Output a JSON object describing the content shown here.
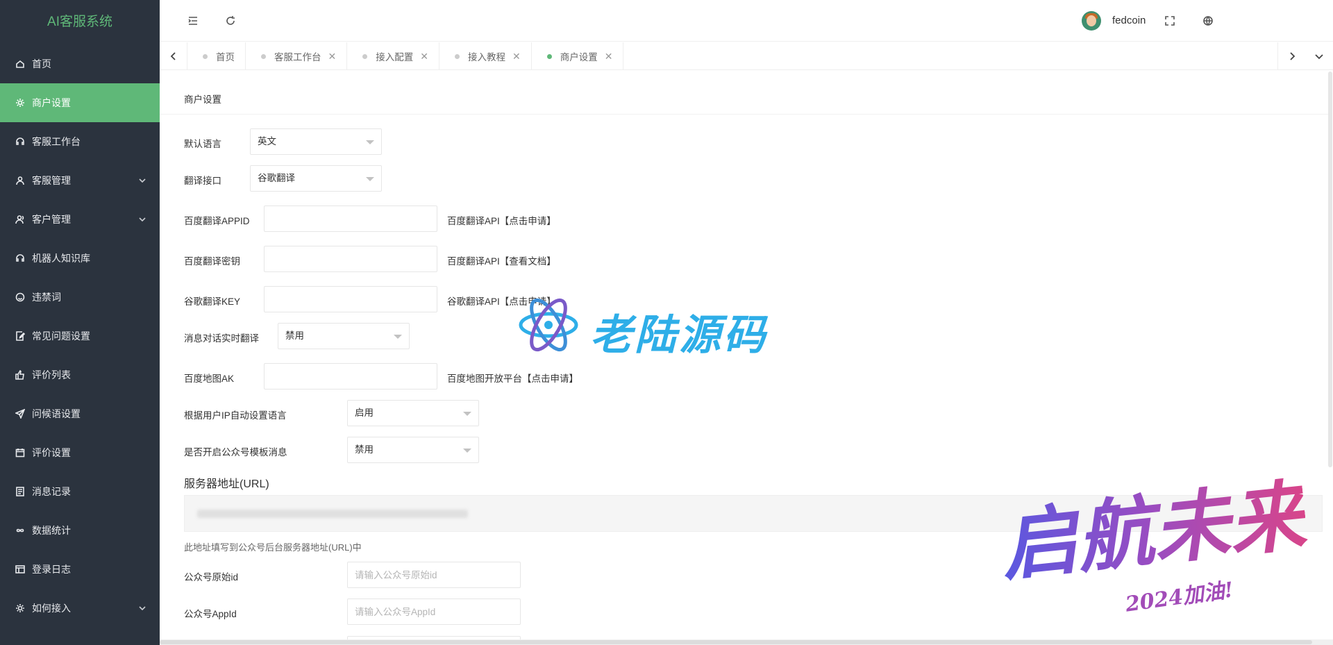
{
  "app": {
    "title": "AI客服系统"
  },
  "sidebar": {
    "items": [
      {
        "label": "首页",
        "icon": "home-icon",
        "active": false,
        "expandable": false
      },
      {
        "label": "商户设置",
        "icon": "gear-icon",
        "active": true,
        "expandable": false
      },
      {
        "label": "客服工作台",
        "icon": "headset-icon",
        "active": false,
        "expandable": false
      },
      {
        "label": "客服管理",
        "icon": "user-icon",
        "active": false,
        "expandable": true
      },
      {
        "label": "客户管理",
        "icon": "user-group-icon",
        "active": false,
        "expandable": true
      },
      {
        "label": "机器人知识库",
        "icon": "headset-icon",
        "active": false,
        "expandable": false
      },
      {
        "label": "违禁词",
        "icon": "smile-icon",
        "active": false,
        "expandable": false
      },
      {
        "label": "常见问题设置",
        "icon": "edit-doc-icon",
        "active": false,
        "expandable": false
      },
      {
        "label": "评价列表",
        "icon": "thumbs-up-icon",
        "active": false,
        "expandable": false
      },
      {
        "label": "问候语设置",
        "icon": "send-icon",
        "active": false,
        "expandable": false
      },
      {
        "label": "评价设置",
        "icon": "calendar-icon",
        "active": false,
        "expandable": false
      },
      {
        "label": "消息记录",
        "icon": "list-doc-icon",
        "active": false,
        "expandable": false
      },
      {
        "label": "数据统计",
        "icon": "infinity-icon",
        "active": false,
        "expandable": false
      },
      {
        "label": "登录日志",
        "icon": "table-icon",
        "active": false,
        "expandable": false
      },
      {
        "label": "如何接入",
        "icon": "gear-icon",
        "active": false,
        "expandable": true
      }
    ]
  },
  "header": {
    "icons": [
      "menu-toggle-icon",
      "refresh-icon",
      "fullscreen-icon",
      "globe-icon"
    ],
    "username": "fedcoin"
  },
  "tabs": [
    {
      "label": "首页",
      "closable": false,
      "active": false
    },
    {
      "label": "客服工作台",
      "closable": true,
      "active": false
    },
    {
      "label": "接入配置",
      "closable": true,
      "active": false
    },
    {
      "label": "接入教程",
      "closable": true,
      "active": false
    },
    {
      "label": "商户设置",
      "closable": true,
      "active": true
    }
  ],
  "tabs_close_glyph": "✕",
  "form": {
    "title": "商户设置",
    "default_language": {
      "label": "默认语言",
      "value": "英文"
    },
    "translate_api": {
      "label": "翻译接口",
      "value": "谷歌翻译"
    },
    "baidu_appid": {
      "label": "百度翻译APPID",
      "value": "",
      "aside": "百度翻译API【点击申请】"
    },
    "baidu_secret": {
      "label": "百度翻译密钥",
      "value": "",
      "aside": "百度翻译API【查看文档】"
    },
    "google_key": {
      "label": "谷歌翻译KEY",
      "value": "",
      "aside": "谷歌翻译API【点击申请】"
    },
    "realtime_translate": {
      "label": "消息对话实时翻译",
      "value": "禁用"
    },
    "baidu_map_ak": {
      "label": "百度地图AK",
      "value": "",
      "aside": "百度地图开放平台【点击申请】"
    },
    "ip_auto_lang": {
      "label": "根据用户IP自动设置语言",
      "value": "启用"
    },
    "mp_template_msg": {
      "label": "是否开启公众号模板消息",
      "value": "禁用"
    },
    "server_url": {
      "heading": "服务器地址(URL)",
      "hint": "此地址填写到公众号后台服务器地址(URL)中"
    },
    "mp_original_id": {
      "label": "公众号原始id",
      "placeholder": "请输入公众号原始id"
    },
    "mp_appid": {
      "label": "公众号AppId",
      "placeholder": "请输入公众号AppId"
    }
  },
  "watermarks": {
    "logo_text": "老陆源码",
    "calligraphy": "启航未来",
    "calligraphy_sub": "2024加油!"
  },
  "colors": {
    "sidebar_bg": "#2b333e",
    "accent": "#5fb878",
    "watermark_blue": "#2eaee8"
  }
}
